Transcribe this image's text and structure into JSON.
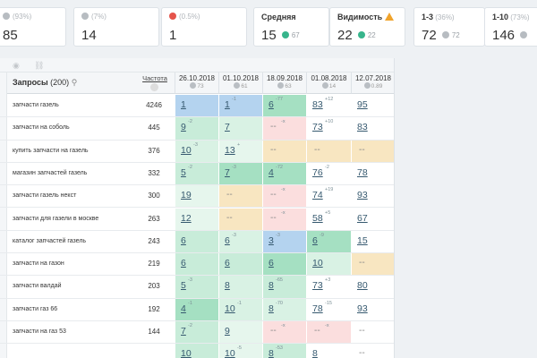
{
  "stats": {
    "card1": {
      "caption": "(93%)",
      "value": "85"
    },
    "card2": {
      "caption": "(7%)",
      "value": "14"
    },
    "card3": {
      "caption": "(0.5%)",
      "value": "1"
    },
    "avg": {
      "label": "Средняя",
      "value": "15",
      "delta": "67"
    },
    "visibility": {
      "label": "Видимость",
      "value": "22",
      "delta": "22"
    },
    "top3": {
      "label": "1-3",
      "caption": "(36%)",
      "value": "72",
      "delta": "72"
    },
    "top10": {
      "label": "1-10",
      "caption": "(73%)",
      "value": "146"
    }
  },
  "table": {
    "queries_label": "Запросы",
    "queries_count": "(200)",
    "frequency_label": "Частота",
    "dates": [
      {
        "date": "26.10.2018",
        "score": "73"
      },
      {
        "date": "01.10.2018",
        "score": "61"
      },
      {
        "date": "18.09.2018",
        "score": "63"
      },
      {
        "date": "01.08.2018",
        "score": "14"
      },
      {
        "date": "12.07.2018",
        "score": "0.89"
      }
    ],
    "rows": [
      {
        "query": "запчасти газель",
        "freq": "4246",
        "c": [
          "1",
          "1",
          "6",
          "83",
          "95"
        ],
        "d": [
          "",
          "-1",
          "-77",
          "+12",
          ""
        ],
        "bg": [
          "blue",
          "blue",
          "green2",
          "white",
          "white"
        ]
      },
      {
        "query": "запчасти на соболь",
        "freq": "445",
        "c": [
          "9",
          "7",
          "--",
          "73",
          "83"
        ],
        "d": [
          "-2",
          "",
          "-x",
          "+10",
          ""
        ],
        "bg": [
          "green1",
          "green3",
          "red",
          "white",
          "white"
        ]
      },
      {
        "query": "купить запчасти на газель",
        "freq": "376",
        "c": [
          "10",
          "13",
          "--",
          "--",
          "--"
        ],
        "d": [
          "-3",
          "+",
          "",
          "",
          ""
        ],
        "bg": [
          "green3",
          "green4",
          "yellow",
          "yellow",
          "yellow"
        ]
      },
      {
        "query": "магазин запчастей газель",
        "freq": "332",
        "c": [
          "5",
          "7",
          "4",
          "76",
          "78"
        ],
        "d": [
          "-2",
          "-3",
          "-72",
          "-2",
          ""
        ],
        "bg": [
          "green1",
          "green2",
          "green2",
          "white",
          "white"
        ]
      },
      {
        "query": "запчасти газель некст",
        "freq": "300",
        "c": [
          "19",
          "--",
          "--",
          "74",
          "93"
        ],
        "d": [
          "",
          "",
          "-x",
          "+19",
          ""
        ],
        "bg": [
          "green4",
          "yellow",
          "red",
          "white",
          "white"
        ]
      },
      {
        "query": "запчасти для газели в москве",
        "freq": "263",
        "c": [
          "12",
          "--",
          "--",
          "58",
          "67"
        ],
        "d": [
          "",
          "",
          "-x",
          "+5",
          ""
        ],
        "bg": [
          "green4",
          "yellow",
          "red",
          "white",
          "white"
        ]
      },
      {
        "query": "каталог запчастей газель",
        "freq": "243",
        "c": [
          "6",
          "6",
          "3",
          "6",
          "15"
        ],
        "d": [
          "",
          "-3",
          "-3",
          "-9",
          ""
        ],
        "bg": [
          "green1",
          "green3",
          "blue",
          "green2",
          "white"
        ]
      },
      {
        "query": "запчасти на газон",
        "freq": "219",
        "c": [
          "6",
          "6",
          "6",
          "10",
          "--"
        ],
        "d": [
          "",
          "",
          "",
          "",
          ""
        ],
        "bg": [
          "green1",
          "green1",
          "green2",
          "green3",
          "yellow"
        ]
      },
      {
        "query": "запчасти валдай",
        "freq": "203",
        "c": [
          "5",
          "8",
          "8",
          "73",
          "80"
        ],
        "d": [
          "-3",
          "",
          "-65",
          "+3",
          ""
        ],
        "bg": [
          "green1",
          "green3",
          "green1",
          "white",
          "white"
        ]
      },
      {
        "query": "запчасти газ 66",
        "freq": "192",
        "c": [
          "4",
          "10",
          "8",
          "78",
          "93"
        ],
        "d": [
          "-1",
          "-1",
          "-70",
          "-15",
          ""
        ],
        "bg": [
          "green2",
          "green3",
          "green3",
          "white",
          "white"
        ]
      },
      {
        "query": "запчасти на газ 53",
        "freq": "144",
        "c": [
          "7",
          "9",
          "--",
          "--",
          "--"
        ],
        "d": [
          "-2",
          "",
          "-x",
          "-x",
          ""
        ],
        "bg": [
          "green1",
          "green4",
          "red",
          "red",
          "white"
        ]
      },
      {
        "query": "",
        "freq": "",
        "c": [
          "10",
          "10",
          "8",
          "8",
          "--"
        ],
        "d": [
          "",
          "-5",
          "-53",
          "",
          ""
        ],
        "bg": [
          "green1",
          "green4",
          "green1",
          "white",
          "white"
        ]
      }
    ]
  }
}
